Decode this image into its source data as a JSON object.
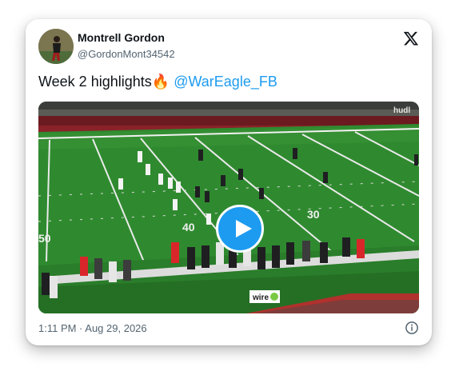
{
  "author": {
    "name": "Montrell Gordon",
    "handle": "@GordonMont34542"
  },
  "tweet": {
    "text": "Week 2 highlights",
    "emoji": "🔥",
    "mention": "@WarEagle_FB"
  },
  "media": {
    "type": "video",
    "watermark": "hudl",
    "field_numbers": [
      "50",
      "40",
      "30"
    ],
    "sign_text": "wire"
  },
  "timestamp": "1:11 PM · Aug 29, 2026",
  "icons": {
    "logo": "x-logo-icon",
    "info": "info-icon",
    "play": "play-icon"
  },
  "colors": {
    "accent": "#1d9bf0",
    "text": "#0f1419",
    "muted": "#536471",
    "field": "#2f8a2f"
  }
}
